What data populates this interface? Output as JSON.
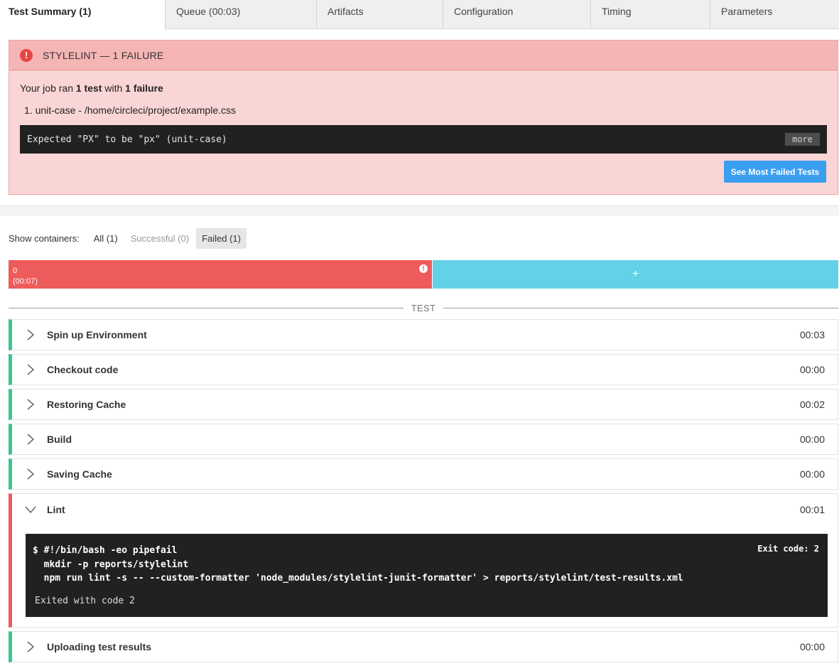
{
  "tabs": [
    {
      "label": "Test Summary (1)"
    },
    {
      "label": "Queue (00:03)"
    },
    {
      "label": "Artifacts"
    },
    {
      "label": "Configuration"
    },
    {
      "label": "Timing"
    },
    {
      "label": "Parameters"
    }
  ],
  "failure": {
    "title": "STYLELINT — 1 FAILURE",
    "ran_prefix": "Your job ran ",
    "ran_tests": "1 test",
    "ran_middle": " with ",
    "ran_failures": "1 failure",
    "item": "1. unit-case - /home/circleci/project/example.css",
    "message": "Expected \"PX\" to be \"px\" (unit-case)",
    "more_label": "more",
    "most_failed_label": "See Most Failed Tests",
    "color": "#ee5b5b"
  },
  "containers": {
    "label": "Show containers:",
    "all": "All (1)",
    "successful": "Successful (0)",
    "failed": "Failed (1)",
    "failed_index": "0",
    "failed_time": "(00:07)",
    "add_label": "+"
  },
  "section_label": "TEST",
  "steps": [
    {
      "name": "Spin up Environment",
      "time": "00:03"
    },
    {
      "name": "Checkout code",
      "time": "00:00"
    },
    {
      "name": "Restoring Cache",
      "time": "00:02"
    },
    {
      "name": "Build",
      "time": "00:00"
    },
    {
      "name": "Saving Cache",
      "time": "00:00"
    }
  ],
  "lint": {
    "name": "Lint",
    "time": "00:01",
    "cmd1": "$ #!/bin/bash -eo pipefail",
    "cmd2": "  mkdir -p reports/stylelint",
    "cmd3": "  npm run lint -s -- --custom-formatter 'node_modules/stylelint-junit-formatter' > reports/stylelint/test-results.xml",
    "exit_code": "Exit code: 2",
    "exited": "Exited with code 2"
  },
  "upload": {
    "name": "Uploading test results",
    "time": "00:00"
  },
  "colors": {
    "success": "#3cc58a",
    "failure": "#ee5b5b",
    "primary": "#3b9ff0",
    "add": "#63d2e6"
  }
}
